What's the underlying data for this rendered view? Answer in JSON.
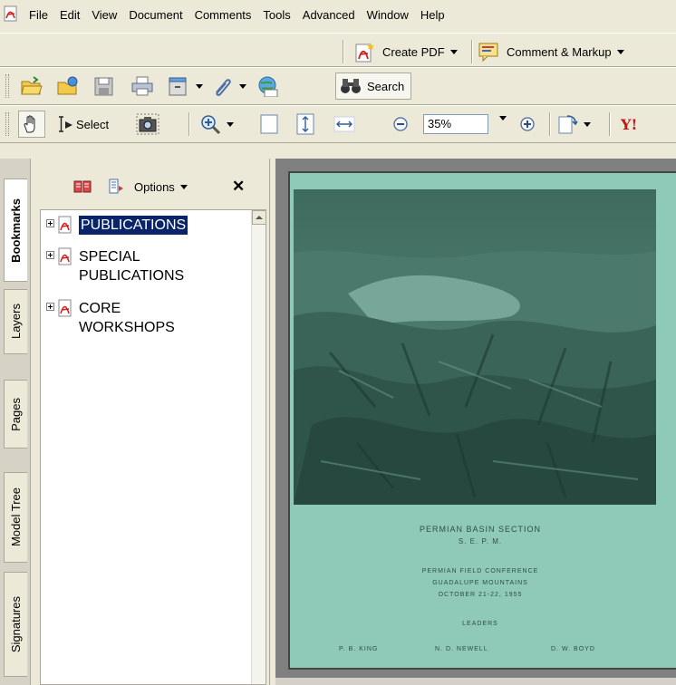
{
  "menu": [
    "File",
    "Edit",
    "View",
    "Document",
    "Comments",
    "Tools",
    "Advanced",
    "Window",
    "Help"
  ],
  "toolbar1": {
    "create_pdf": "Create PDF",
    "comment_markup": "Comment & Markup"
  },
  "toolbar2": {
    "search": "Search"
  },
  "toolbar3": {
    "select": "Select",
    "zoom_value": "35%"
  },
  "nav_tabs": [
    "Bookmarks",
    "Layers",
    "Pages",
    "Model Tree",
    "Signatures"
  ],
  "bookmarks_panel": {
    "options": "Options",
    "items": [
      {
        "label": "PUBLICATIONS",
        "selected": true
      },
      {
        "label": "SPECIAL\nPUBLICATIONS",
        "selected": false
      },
      {
        "label": "CORE\nWORKSHOPS",
        "selected": false
      }
    ]
  },
  "document": {
    "line1": "PERMIAN BASIN SECTION",
    "line2": "S. E. P. M.",
    "line3": "PERMIAN FIELD CONFERENCE",
    "line4": "GUADALUPE MOUNTAINS",
    "line5": "OCTOBER 21-22, 1955",
    "leaders_title": "LEADERS",
    "leader_1": "P. B. KING",
    "leader_2": "N. D. NEWELL",
    "leader_3": "D. W. BOYD",
    "page_color": "#8fc9b7"
  },
  "colors": {
    "chrome": "#ece9d8",
    "selection": "#0a246a",
    "doc_background": "#808080"
  }
}
